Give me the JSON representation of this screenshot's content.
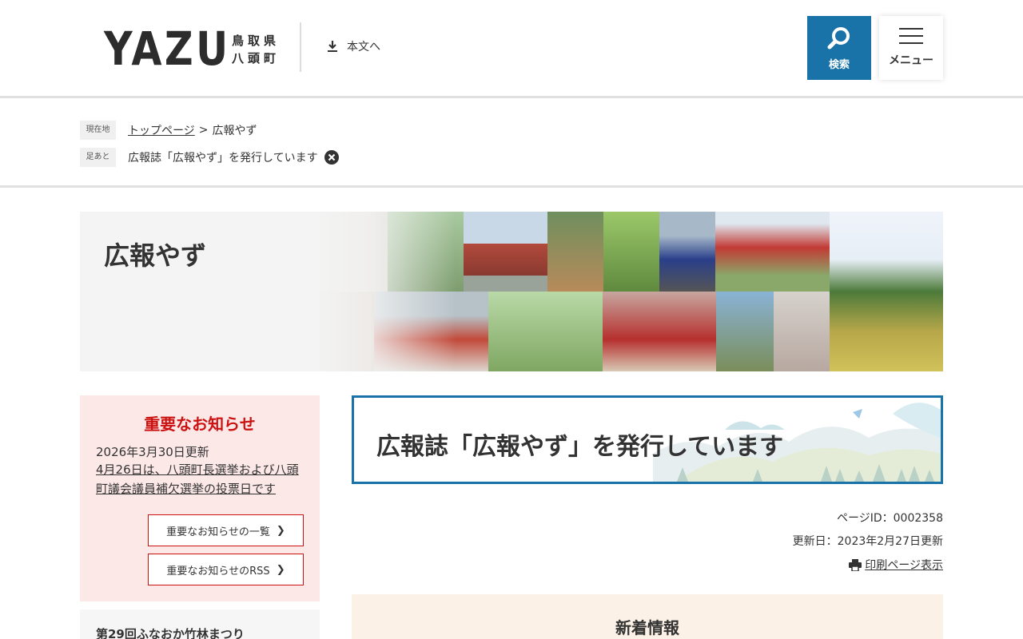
{
  "header": {
    "logo_text": "YAZU",
    "logo_pref_line1": "鳥取県",
    "logo_pref_line2": "八頭町",
    "skip_link": "本文へ",
    "search_label": "検索",
    "menu_label": "メニュー"
  },
  "breadcrumb": {
    "current_tag": "現在地",
    "top_page": "トップページ",
    "separator": ">",
    "current": "広報やず",
    "history_tag": "足あと",
    "history_item": "広報誌「広報やず」を発行しています"
  },
  "hero": {
    "title": "広報やず"
  },
  "notice": {
    "title": "重要なお知らせ",
    "date": "2026年3月30日更新",
    "link": "4月26日は、八頭町長選挙および八頭町議会議員補欠選挙の投票日です",
    "list_button": "重要なお知らせの一覧",
    "rss_button": "重要なお知らせのRSS"
  },
  "sidebar_event": {
    "link": "第29回ふなおか竹林まつり"
  },
  "main": {
    "heading": "広報誌「広報やず」を発行しています",
    "page_id": "ページID：0002358",
    "updated": "更新日：2023年2月27日更新",
    "print": "印刷ページ表示",
    "news_title": "新着情報"
  },
  "colors": {
    "accent_blue": "#1a73a8",
    "notice_bg": "#fde8e8",
    "notice_red": "#cc1111",
    "news_bg": "#fbf1e6"
  }
}
